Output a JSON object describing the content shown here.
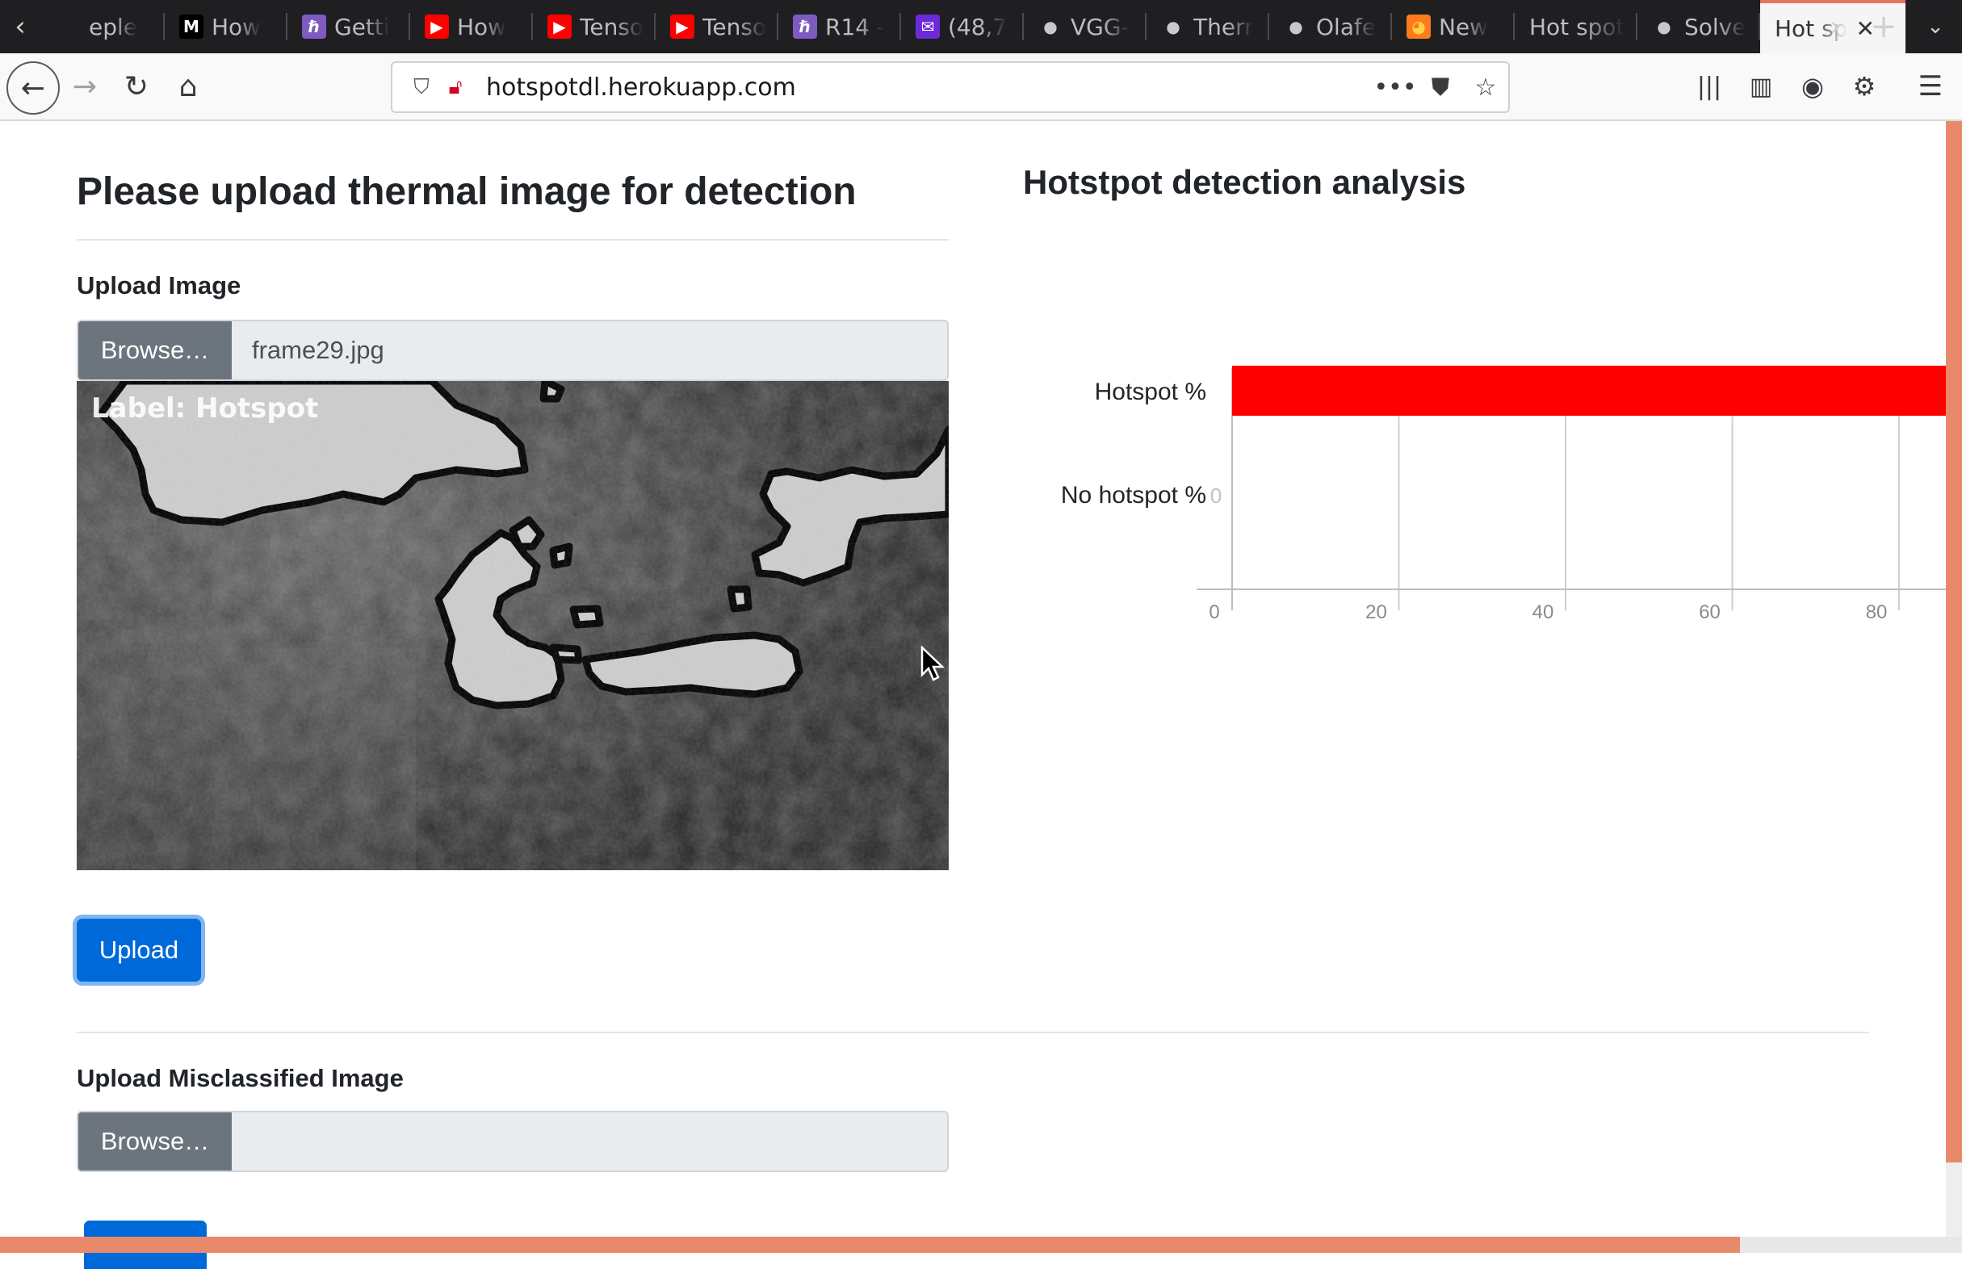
{
  "browser": {
    "tabs": [
      {
        "label": "eple",
        "icon": "page-icon"
      },
      {
        "label": "How",
        "icon": "medium-icon"
      },
      {
        "label": "Getti",
        "icon": "heroku-icon"
      },
      {
        "label": "How",
        "icon": "youtube-icon"
      },
      {
        "label": "Tenso",
        "icon": "youtube-icon"
      },
      {
        "label": "Tenso",
        "icon": "youtube-icon"
      },
      {
        "label": "R14 -",
        "icon": "heroku-icon"
      },
      {
        "label": "(48,7",
        "icon": "mail-icon"
      },
      {
        "label": "VGG-",
        "icon": "github-icon"
      },
      {
        "label": "Therr",
        "icon": "github-icon"
      },
      {
        "label": "Olafe",
        "icon": "github-icon"
      },
      {
        "label": "New",
        "icon": "firefox-icon"
      },
      {
        "label": "Hot spot",
        "icon": "none"
      },
      {
        "label": "Solve",
        "icon": "github-icon"
      },
      {
        "label": "Hot sp",
        "icon": "none",
        "active": true
      }
    ],
    "url": "hotspotdl.herokuapp.com"
  },
  "left": {
    "title": "Please upload thermal image for detection",
    "upload_label": "Upload Image",
    "browse_label": "Browse…",
    "file_name": "frame29.jpg",
    "image_overlay_label": "Label: Hotspot",
    "upload_button": "Upload",
    "misclassified_label": "Upload Misclassified Image",
    "browse_label_2": "Browse…",
    "file_name_2": ""
  },
  "right": {
    "title": "Hotstpot detection analysis"
  },
  "chart_data": {
    "type": "bar",
    "orientation": "horizontal",
    "categories": [
      "Hotspot %",
      "No hotspot %"
    ],
    "values": [
      100,
      0
    ],
    "data_labels": [
      "",
      "0"
    ],
    "bar_color": "#ff0000",
    "xticks": [
      0,
      20,
      40,
      60,
      80
    ],
    "xlim": [
      0,
      86
    ],
    "grid": true,
    "title": "",
    "xlabel": "",
    "ylabel": ""
  }
}
